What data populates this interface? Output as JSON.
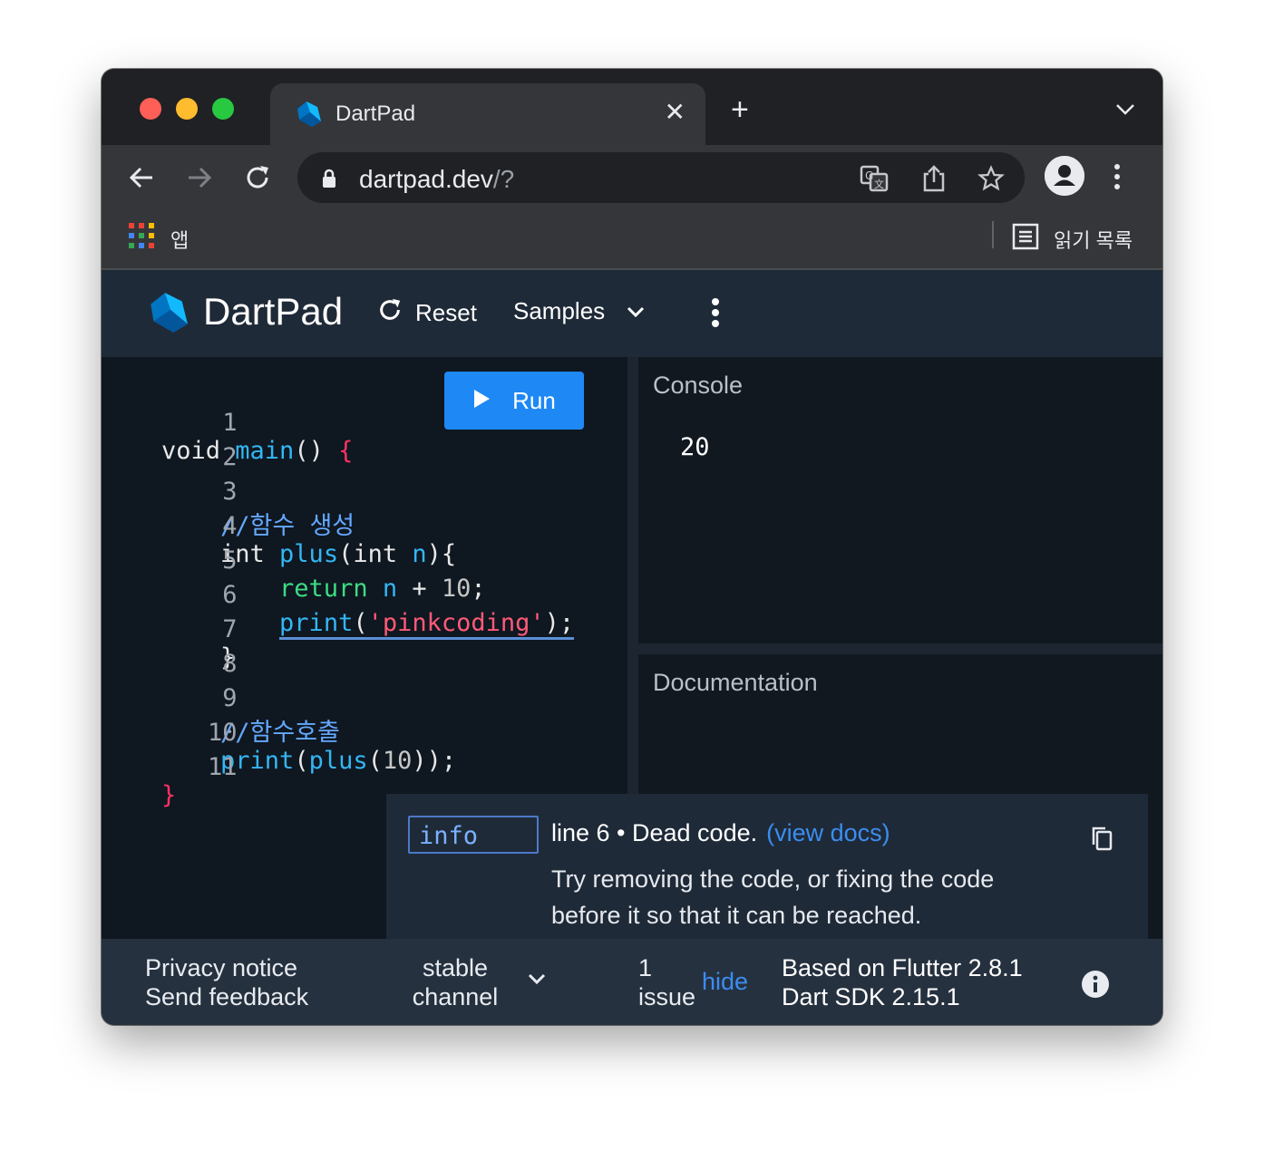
{
  "browser": {
    "tab_title": "DartPad",
    "url_host": "dartpad.dev",
    "url_path": "/?",
    "apps_label": "앱",
    "reading_list_label": "읽기 목록"
  },
  "dartpad": {
    "title": "DartPad",
    "reset_label": "Reset",
    "samples_label": "Samples",
    "run_label": "Run"
  },
  "editor": {
    "line_numbers": [
      "1",
      "2",
      "3",
      "4",
      "5",
      "6",
      "7",
      "8",
      "9",
      "10",
      "11"
    ],
    "code": {
      "l1_void": "void ",
      "l1_main": "main",
      "l1_paren": "() ",
      "l1_brace": "{",
      "l3_comment": "    //함수 생성",
      "l4_int": "    int ",
      "l4_plus": "plus",
      "l4_open": "(int ",
      "l4_n": "n",
      "l4_close": "){",
      "l5_return": "        return ",
      "l5_n": "n",
      "l5_plus": " + ",
      "l5_num": "10",
      "l5_semi": ";",
      "l6_indent": "        ",
      "l6_print": "print",
      "l6_open": "(",
      "l6_str": "'pinkcoding'",
      "l6_close": ");",
      "l7_brace": "    }",
      "l9_comment": "    //함수호출",
      "l10_indent": "    ",
      "l10_print": "print",
      "l10_open": "(",
      "l10_plus": "plus",
      "l10_open2": "(",
      "l10_num": "10",
      "l10_close": "));",
      "l11_brace": "}"
    }
  },
  "console": {
    "title": "Console",
    "output": "20"
  },
  "documentation": {
    "title": "Documentation"
  },
  "issue": {
    "badge": "info",
    "location": "line 6 • Dead code.",
    "docs_link": "(view docs)",
    "description": "Try removing the code, or fixing the code before it so that it can be reached."
  },
  "footer": {
    "privacy": "Privacy notice",
    "feedback": "Send feedback",
    "channel": "stable channel",
    "issue_count": "1",
    "issue_word": "issue",
    "hide_label": "hide",
    "flutter_version": "Based on Flutter 2.8.1",
    "dart_version": "Dart SDK 2.15.1"
  },
  "colors": {
    "accent": "#1e88f5",
    "header_bg": "#1f2a38",
    "editor_bg": "#0f1720"
  }
}
